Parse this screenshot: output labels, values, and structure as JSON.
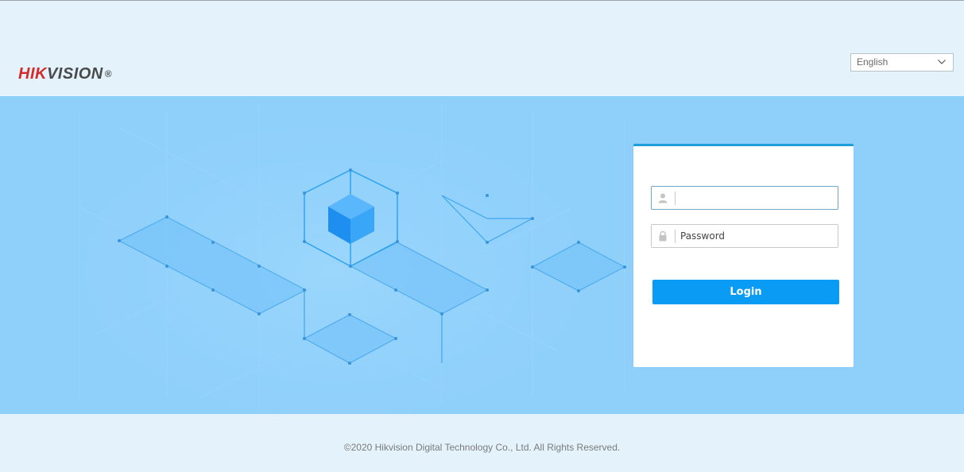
{
  "header": {
    "logo_text_red": "HIK",
    "logo_text_dark": "VISION",
    "logo_registered": "®",
    "language": {
      "selected": "English",
      "icon": "chevron-down-icon"
    }
  },
  "login": {
    "username": {
      "value": "",
      "placeholder": "",
      "icon": "user-icon"
    },
    "password": {
      "value": "",
      "placeholder": "Password",
      "icon": "lock-icon"
    },
    "login_label": "Login"
  },
  "footer": {
    "copyright": "©2020 Hikvision Digital Technology Co., Ltd. All Rights Reserved."
  },
  "colors": {
    "banner": "#8fd0fb",
    "page_bg": "#e4f3fb",
    "button": "#0a9bf5",
    "brand_red": "#d42a2a",
    "card_accent": "#1d9ed8"
  }
}
